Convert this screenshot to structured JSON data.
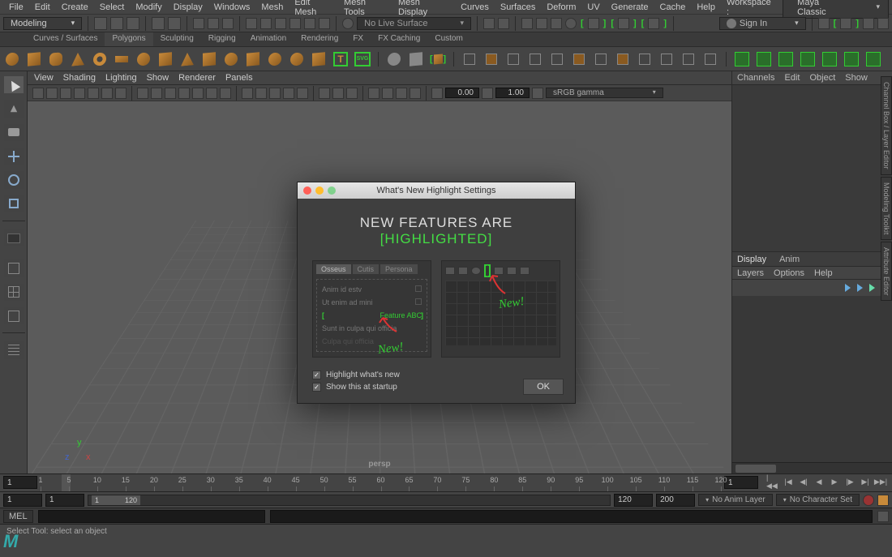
{
  "menubar": {
    "items": [
      "File",
      "Edit",
      "Create",
      "Select",
      "Modify",
      "Display",
      "Windows",
      "Mesh",
      "Edit Mesh",
      "Mesh Tools",
      "Mesh Display",
      "Curves",
      "Surfaces",
      "Deform",
      "UV",
      "Generate",
      "Cache",
      "Help"
    ],
    "workspace_label": "Workspace :",
    "workspace_value": "Maya Classic"
  },
  "toolbar": {
    "mode": "Modeling",
    "nolive": "No Live Surface",
    "signin": "Sign In"
  },
  "shelf": {
    "tabs": [
      "Curves / Surfaces",
      "Polygons",
      "Sculpting",
      "Rigging",
      "Animation",
      "Rendering",
      "FX",
      "FX Caching",
      "Custom"
    ],
    "active_tab": 1
  },
  "viewport": {
    "menus": [
      "View",
      "Shading",
      "Lighting",
      "Show",
      "Renderer",
      "Panels"
    ],
    "num1": "0.00",
    "num2": "1.00",
    "gamma": "sRGB gamma",
    "label": "persp"
  },
  "rightpanel": {
    "menus": [
      "Channels",
      "Edit",
      "Object",
      "Show"
    ],
    "tabs": [
      "Display",
      "Anim"
    ],
    "submenus": [
      "Layers",
      "Options",
      "Help"
    ]
  },
  "sidetabs": [
    "Channel Box / Layer Editor",
    "Modeling Toolkit",
    "Attribute Editor"
  ],
  "timeline": {
    "start_field": "1",
    "ticks": [
      "1",
      "5",
      "10",
      "15",
      "20",
      "25",
      "30",
      "35",
      "40",
      "45",
      "50",
      "55",
      "60",
      "65",
      "70",
      "75",
      "80",
      "85",
      "90",
      "95",
      "100",
      "105",
      "110",
      "115",
      "120"
    ],
    "frame_field": "1"
  },
  "range": {
    "start": "1",
    "end_in": "1",
    "in": "1",
    "out": "120",
    "end": "120",
    "total": "200",
    "animlayer": "No Anim Layer",
    "charset": "No Character Set"
  },
  "mel": {
    "label": "MEL"
  },
  "status": {
    "text": "Select Tool: select an object"
  },
  "dialog": {
    "title": "What's New Highlight Settings",
    "headline_pre": "NEW  FEATURES  ARE ",
    "headline_hl": "[HIGHLIGHTED]",
    "left_tabs": [
      "Osseus",
      "Cutis",
      "Persona"
    ],
    "list": [
      "Anim id estv",
      "Ut enim ad mini",
      "Feature ABC",
      "Sunt in culpa qui officia",
      "Culpa qui officia"
    ],
    "new_label": "New!",
    "check1": "Highlight what's new",
    "check2": "Show this at startup",
    "ok": "OK"
  }
}
